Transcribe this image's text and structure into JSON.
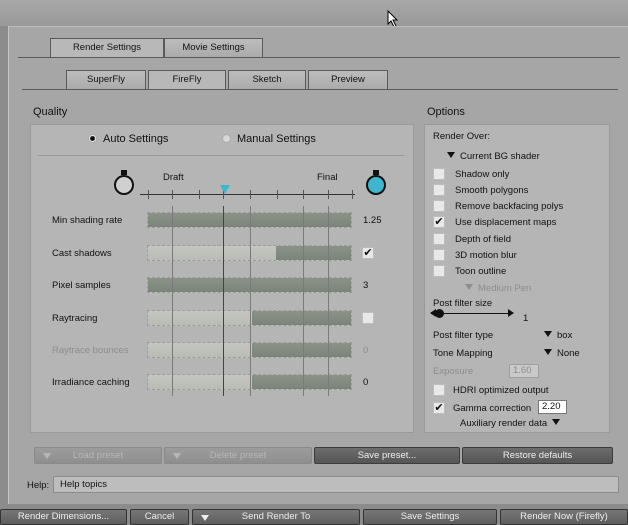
{
  "tabs_main": [
    {
      "label": "Render Settings"
    },
    {
      "label": "Movie Settings"
    }
  ],
  "tabs_sub": [
    {
      "label": "SuperFly"
    },
    {
      "label": "FireFly"
    },
    {
      "label": "Sketch"
    },
    {
      "label": "Preview"
    }
  ],
  "quality": {
    "title": "Quality",
    "auto_label": "Auto Settings",
    "manual_label": "Manual Settings",
    "draft_label": "Draft",
    "final_label": "Final",
    "quality_level": 0.38,
    "rows": [
      {
        "label": "Min shading rate",
        "value": "1.25",
        "fill": 0.0,
        "fill_start": 0.0,
        "dim": false,
        "type": "number"
      },
      {
        "label": "Cast shadows",
        "value": "",
        "fill": 0.63,
        "dim": false,
        "type": "check",
        "checked": true
      },
      {
        "label": "Pixel samples",
        "value": "3",
        "fill": 0.0,
        "dim": false,
        "type": "number"
      },
      {
        "label": "Raytracing",
        "value": "",
        "fill": 0.51,
        "dim": false,
        "type": "check",
        "checked": false
      },
      {
        "label": "Raytrace bounces",
        "value": "0",
        "fill": 0.51,
        "dim": true,
        "type": "number"
      },
      {
        "label": "Irradiance caching",
        "value": "0",
        "fill": 0.51,
        "dim": false,
        "type": "number"
      }
    ]
  },
  "options": {
    "title": "Options",
    "render_over_label": "Render Over:",
    "render_over_value": "Current BG shader",
    "checks": [
      {
        "label": "Shadow only",
        "checked": false
      },
      {
        "label": "Smooth polygons",
        "checked": false
      },
      {
        "label": "Remove backfacing polys",
        "checked": false
      },
      {
        "label": "Use displacement maps",
        "checked": true
      },
      {
        "label": "Depth of field",
        "checked": false
      },
      {
        "label": "3D motion blur",
        "checked": false
      },
      {
        "label": "Toon outline",
        "checked": false
      }
    ],
    "toon_pen": "Medium Pen",
    "post_filter_size_label": "Post filter size",
    "post_filter_size_value": "1",
    "post_filter_size_level": 0.1,
    "post_filter_type_label": "Post filter type",
    "post_filter_type_value": "box",
    "tone_mapping_label": "Tone Mapping",
    "tone_mapping_value": "None",
    "exposure_label": "Exposure",
    "exposure_value": "1.60",
    "hdri_label": "HDRI optimized output",
    "hdri_checked": false,
    "gamma_label": "Gamma correction",
    "gamma_checked": true,
    "gamma_value": "2.20",
    "aux_label": "Auxiliary render data"
  },
  "preset_buttons": {
    "load": "Load preset",
    "delete": "Delete preset",
    "save": "Save preset...",
    "restore": "Restore defaults"
  },
  "help": {
    "label": "Help:",
    "text": "Help topics"
  },
  "bottom": {
    "dimensions": "Render Dimensions...",
    "cancel": "Cancel",
    "send": "Send Render To",
    "save": "Save Settings",
    "render_now": "Render Now (Firefly)"
  }
}
